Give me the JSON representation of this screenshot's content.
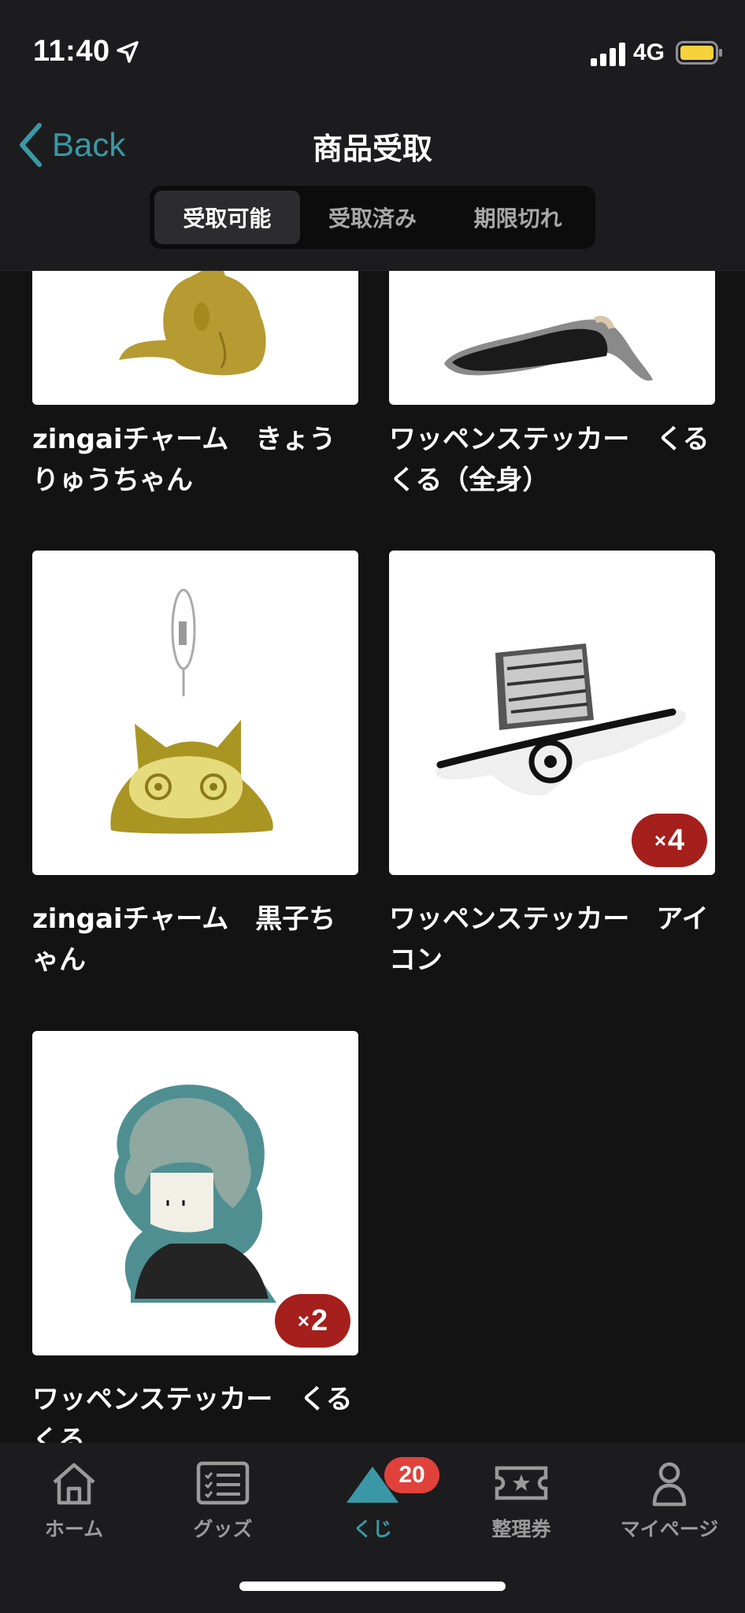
{
  "status": {
    "time": "11:40",
    "network": "4G"
  },
  "nav": {
    "back_label": "Back",
    "title": "商品受取"
  },
  "segments": [
    {
      "label": "受取可能",
      "active": true
    },
    {
      "label": "受取済み",
      "active": false
    },
    {
      "label": "期限切れ",
      "active": false
    }
  ],
  "items": [
    {
      "title": "zingaiチャーム　きょうりゅうちゃん",
      "quantity": null
    },
    {
      "title": "ワッペンステッカー　くるくる（全身）",
      "quantity": null
    },
    {
      "title": "zingaiチャーム　黒子ちゃん",
      "quantity": null
    },
    {
      "title": "ワッペンステッカー　アイコン",
      "quantity": "4",
      "quantity_prefix": "×"
    },
    {
      "title": "ワッペンステッカー　くるくる",
      "quantity": "2",
      "quantity_prefix": "×"
    }
  ],
  "tabbar": {
    "tabs": [
      {
        "label": "ホーム",
        "icon": "home-icon",
        "active": false
      },
      {
        "label": "グッズ",
        "icon": "goods-list-icon",
        "active": false
      },
      {
        "label": "くじ",
        "icon": "kuji-triangle-icon",
        "active": true
      },
      {
        "label": "整理券",
        "icon": "ticket-icon",
        "active": false
      },
      {
        "label": "マイページ",
        "icon": "person-icon",
        "active": false
      }
    ],
    "kuji_badge": "20"
  },
  "colors": {
    "accent": "#3a98a6",
    "badge_red": "#a51f1c",
    "notification_red": "#e0423b",
    "background": "#131313"
  }
}
